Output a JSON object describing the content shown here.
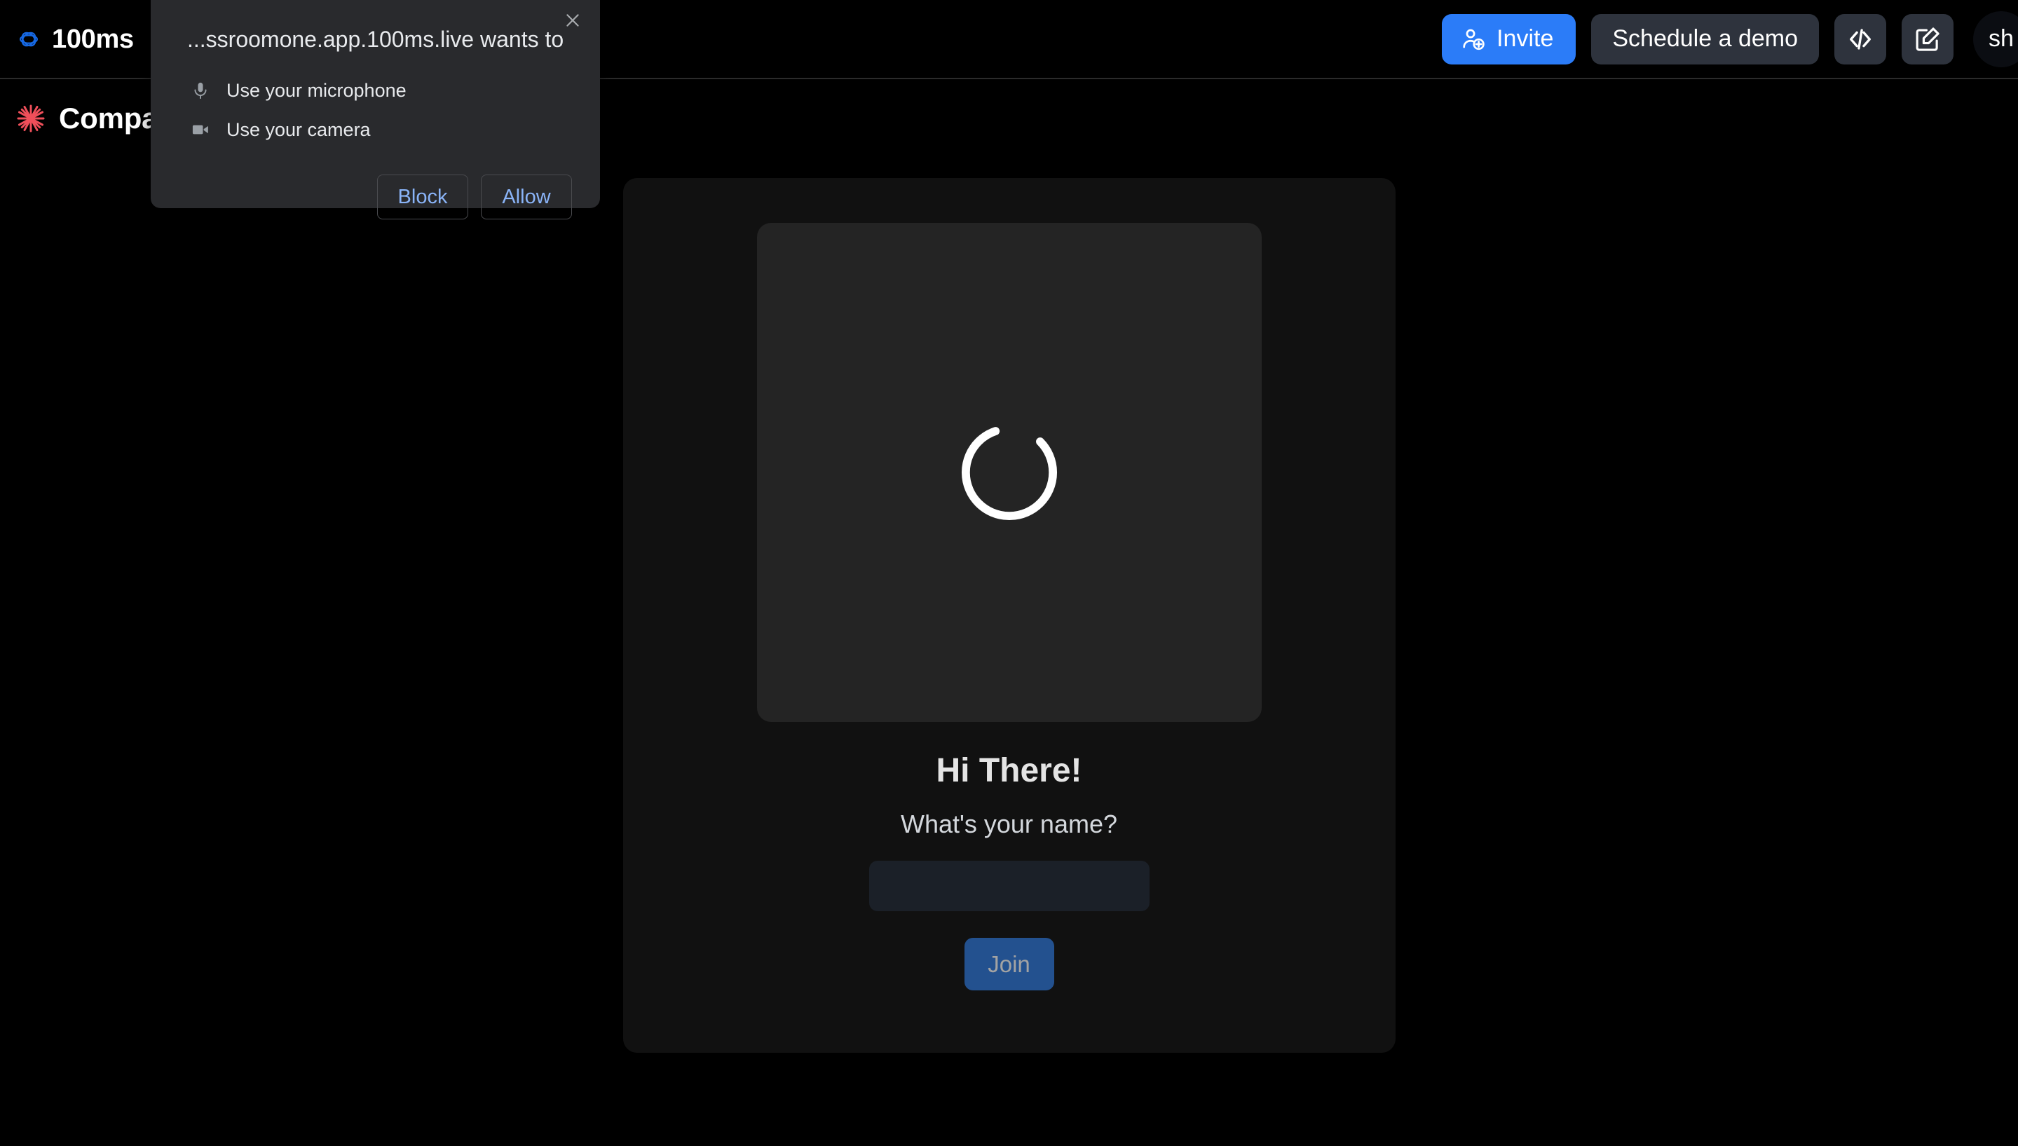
{
  "header": {
    "brand_name": "100ms",
    "brand_logo_icon": "100ms-infinity-logo",
    "invite_label": "Invite",
    "invite_icon": "person-add-icon",
    "invite_color": "#2b7cf8",
    "schedule_demo_label": "Schedule a demo",
    "code_icon": "code-brackets-icon",
    "edit_icon": "edit-square-pen-icon",
    "avatar_initials": "sh"
  },
  "subheader": {
    "company_name": "Company",
    "company_logo_icon": "red-starburst-asterisk-icon",
    "company_logo_color": "#ef4f5a"
  },
  "join_card": {
    "spinner_icon": "loading-spinner-icon",
    "greeting": "Hi There!",
    "prompt": "What's your name?",
    "name_input_value": "",
    "name_input_placeholder": "",
    "join_label": "Join",
    "join_color": "#23518f"
  },
  "permission_dialog": {
    "title": "...ssroomone.app.100ms.live wants to",
    "close_icon": "close-x-icon",
    "permissions": [
      {
        "icon": "microphone-icon",
        "label": "Use your microphone"
      },
      {
        "icon": "camera-video-icon",
        "label": "Use your camera"
      }
    ],
    "block_label": "Block",
    "allow_label": "Allow",
    "action_color": "#8ab4f8"
  }
}
